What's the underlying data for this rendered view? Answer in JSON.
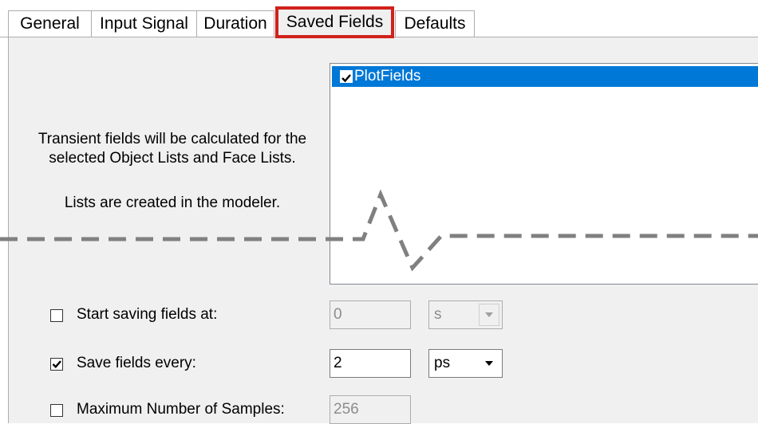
{
  "tabs": [
    {
      "label": "General"
    },
    {
      "label": "Input Signal"
    },
    {
      "label": "Duration"
    },
    {
      "label": "Saved Fields",
      "active": true
    },
    {
      "label": "Defaults"
    }
  ],
  "info": {
    "line1": "Transient fields will be calculated for the",
    "line2": "selected Object Lists and Face Lists.",
    "line3": "Lists are created in the modeler."
  },
  "list": {
    "items": [
      {
        "label": "PlotFields",
        "checked": true,
        "selected": true
      }
    ]
  },
  "start_saving": {
    "label": "Start saving fields at:",
    "checked": false,
    "value": "0",
    "unit": "s",
    "enabled": false
  },
  "save_every": {
    "label": "Save fields every:",
    "checked": true,
    "value": "2",
    "unit": "ps",
    "enabled": true
  },
  "max_samples": {
    "label": "Maximum Number of Samples:",
    "checked": false,
    "value": "256",
    "enabled": false
  },
  "colors": {
    "selection": "#0078d7",
    "highlight_border": "#d0221b",
    "panel": "#f0f0f0"
  }
}
